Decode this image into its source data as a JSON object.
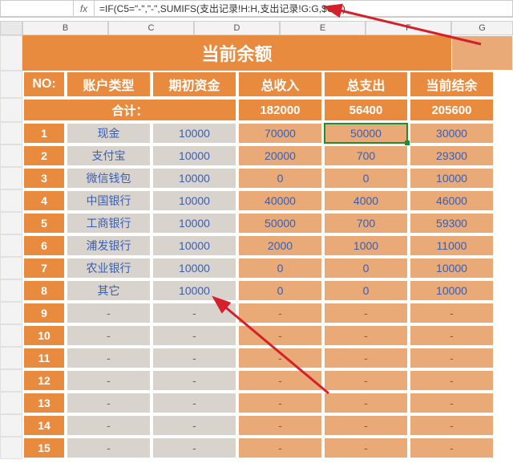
{
  "formula_bar": {
    "name_box": "",
    "fx_label": "fx",
    "formula": "=IF(C5=\"-\",\"-\",SUMIFS(支出记录!H:H,支出记录!G:G,$C5))"
  },
  "col_headers": [
    "",
    "B",
    "C",
    "D",
    "E",
    "F",
    "G"
  ],
  "title": "当前余额",
  "headers": {
    "no": "NO:",
    "acct_type": "账户类型",
    "initial": "期初资金",
    "income": "总收入",
    "expense": "总支出",
    "balance": "当前结余"
  },
  "totals": {
    "label": "合计：",
    "income": "182000",
    "expense": "56400",
    "balance": "205600"
  },
  "rows": [
    {
      "no": "1",
      "type": "现金",
      "init": "10000",
      "inc": "70000",
      "exp": "50000",
      "bal": "30000"
    },
    {
      "no": "2",
      "type": "支付宝",
      "init": "10000",
      "inc": "20000",
      "exp": "700",
      "bal": "29300"
    },
    {
      "no": "3",
      "type": "微信钱包",
      "init": "10000",
      "inc": "0",
      "exp": "0",
      "bal": "10000"
    },
    {
      "no": "4",
      "type": "中国银行",
      "init": "10000",
      "inc": "40000",
      "exp": "4000",
      "bal": "46000"
    },
    {
      "no": "5",
      "type": "工商银行",
      "init": "10000",
      "inc": "50000",
      "exp": "700",
      "bal": "59300"
    },
    {
      "no": "6",
      "type": "浦发银行",
      "init": "10000",
      "inc": "2000",
      "exp": "1000",
      "bal": "11000"
    },
    {
      "no": "7",
      "type": "农业银行",
      "init": "10000",
      "inc": "0",
      "exp": "0",
      "bal": "10000"
    },
    {
      "no": "8",
      "type": "其它",
      "init": "10000",
      "inc": "0",
      "exp": "0",
      "bal": "10000"
    },
    {
      "no": "9",
      "type": "-",
      "init": "-",
      "inc": "-",
      "exp": "-",
      "bal": "-"
    },
    {
      "no": "10",
      "type": "-",
      "init": "-",
      "inc": "-",
      "exp": "-",
      "bal": "-"
    },
    {
      "no": "11",
      "type": "-",
      "init": "-",
      "inc": "-",
      "exp": "-",
      "bal": "-"
    },
    {
      "no": "12",
      "type": "-",
      "init": "-",
      "inc": "-",
      "exp": "-",
      "bal": "-"
    },
    {
      "no": "13",
      "type": "-",
      "init": "-",
      "inc": "-",
      "exp": "-",
      "bal": "-"
    },
    {
      "no": "14",
      "type": "-",
      "init": "-",
      "inc": "-",
      "exp": "-",
      "bal": "-"
    },
    {
      "no": "15",
      "type": "-",
      "init": "-",
      "inc": "-",
      "exp": "-",
      "bal": "-"
    }
  ],
  "selected_cell": "F5",
  "colors": {
    "orange": "#e88b3e",
    "light_orange": "#e9aa77",
    "gray_fill": "#d9d3ce",
    "value_blue": "#3a5fb0",
    "arrow_red": "#d3202a"
  }
}
